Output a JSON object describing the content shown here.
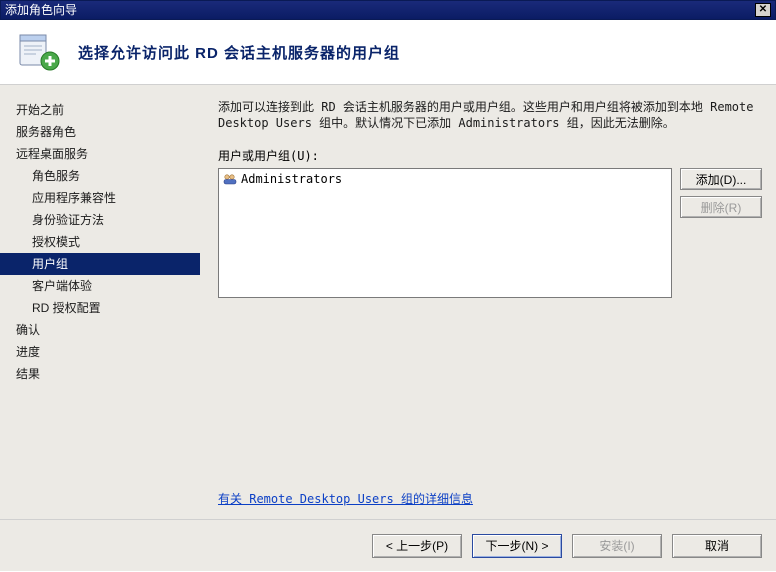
{
  "window": {
    "title": "添加角色向导",
    "close_label": "✕"
  },
  "header": {
    "title": "选择允许访问此 RD 会话主机服务器的用户组"
  },
  "sidebar": {
    "items": [
      {
        "label": "开始之前",
        "sub": false,
        "selected": false
      },
      {
        "label": "服务器角色",
        "sub": false,
        "selected": false
      },
      {
        "label": "远程桌面服务",
        "sub": false,
        "selected": false
      },
      {
        "label": "角色服务",
        "sub": true,
        "selected": false
      },
      {
        "label": "应用程序兼容性",
        "sub": true,
        "selected": false
      },
      {
        "label": "身份验证方法",
        "sub": true,
        "selected": false
      },
      {
        "label": "授权模式",
        "sub": true,
        "selected": false
      },
      {
        "label": "用户组",
        "sub": true,
        "selected": true
      },
      {
        "label": "客户端体验",
        "sub": true,
        "selected": false
      },
      {
        "label": "RD 授权配置",
        "sub": true,
        "selected": false
      },
      {
        "label": "确认",
        "sub": false,
        "selected": false
      },
      {
        "label": "进度",
        "sub": false,
        "selected": false
      },
      {
        "label": "结果",
        "sub": false,
        "selected": false
      }
    ]
  },
  "content": {
    "description": "添加可以连接到此 RD 会话主机服务器的用户或用户组。这些用户和用户组将被添加到本地 Remote Desktop Users 组中。默认情况下已添加 Administrators 组，因此无法删除。",
    "list_label": "用户或用户组(U):",
    "list_items": [
      "Administrators"
    ],
    "add_label": "添加(D)...",
    "remove_label": "删除(R)",
    "link_text": "有关 Remote Desktop Users 组的详细信息"
  },
  "footer": {
    "prev": "< 上一步(P)",
    "next": "下一步(N) >",
    "install": "安装(I)",
    "cancel": "取消"
  }
}
